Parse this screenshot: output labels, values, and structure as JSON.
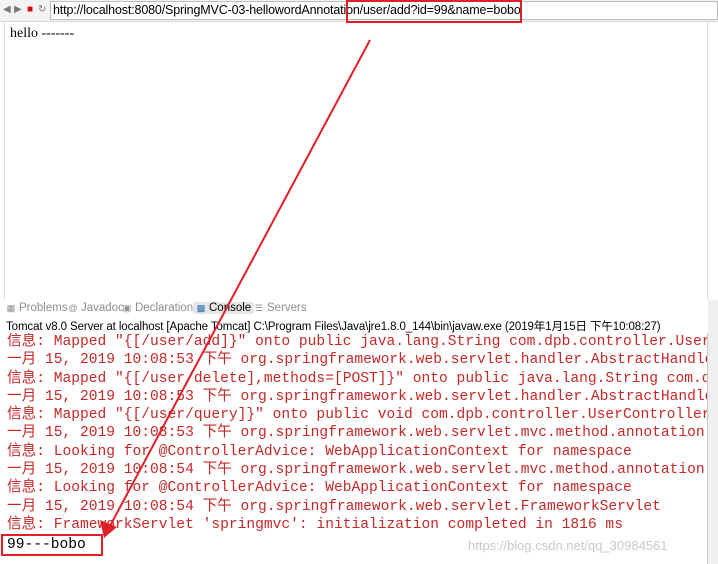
{
  "browser": {
    "url": "http://localhost:8080/SpringMVC-03-hellowordAnnotation/user/add?id=99&name=bobo",
    "nav_icons": [
      "back-icon",
      "forward-icon",
      "stop-icon",
      "refresh-icon"
    ]
  },
  "page": {
    "body_text": "hello -------"
  },
  "console": {
    "tabs": [
      {
        "label": "Problems",
        "icon": "problems-icon"
      },
      {
        "label": "Javadoc",
        "icon": "javadoc-icon"
      },
      {
        "label": "Declaration",
        "icon": "declaration-icon"
      },
      {
        "label": "Console",
        "icon": "console-icon",
        "active": true
      },
      {
        "label": "Servers",
        "icon": "servers-icon"
      }
    ],
    "info": "Tomcat v8.0 Server at localhost [Apache Tomcat] C:\\Program Files\\Java\\jre1.8.0_144\\bin\\javaw.exe (2019年1月15日 下午10:08:27)",
    "lines": [
      "信息: Mapped \"{[/user/add]}\" onto public java.lang.String com.dpb.controller.UserController.add",
      "一月 15, 2019 10:08:53 下午 org.springframework.web.servlet.handler.AbstractHandlerMethodMapping",
      "信息: Mapped \"{[/user/delete],methods=[POST]}\" onto public java.lang.String com.dpb.controller",
      "一月 15, 2019 10:08:53 下午 org.springframework.web.servlet.handler.AbstractHandlerMethodMapping",
      "信息: Mapped \"{[/user/query]}\" onto public void com.dpb.controller.UserController.query",
      "一月 15, 2019 10:08:53 下午 org.springframework.web.servlet.mvc.method.annotation",
      "信息: Looking for @ControllerAdvice: WebApplicationContext for namespace",
      "一月 15, 2019 10:08:54 下午 org.springframework.web.servlet.mvc.method.annotation",
      "信息: Looking for @ControllerAdvice: WebApplicationContext for namespace",
      "一月 15, 2019 10:08:54 下午 org.springframework.web.servlet.FrameworkServlet",
      "信息: FrameworkServlet 'springmvc': initialization completed in 1816 ms"
    ],
    "output": "99---bobo",
    "watermark": "https://blog.csdn.net/qq_30984561"
  },
  "annotation": {
    "color": "#e21f26"
  }
}
